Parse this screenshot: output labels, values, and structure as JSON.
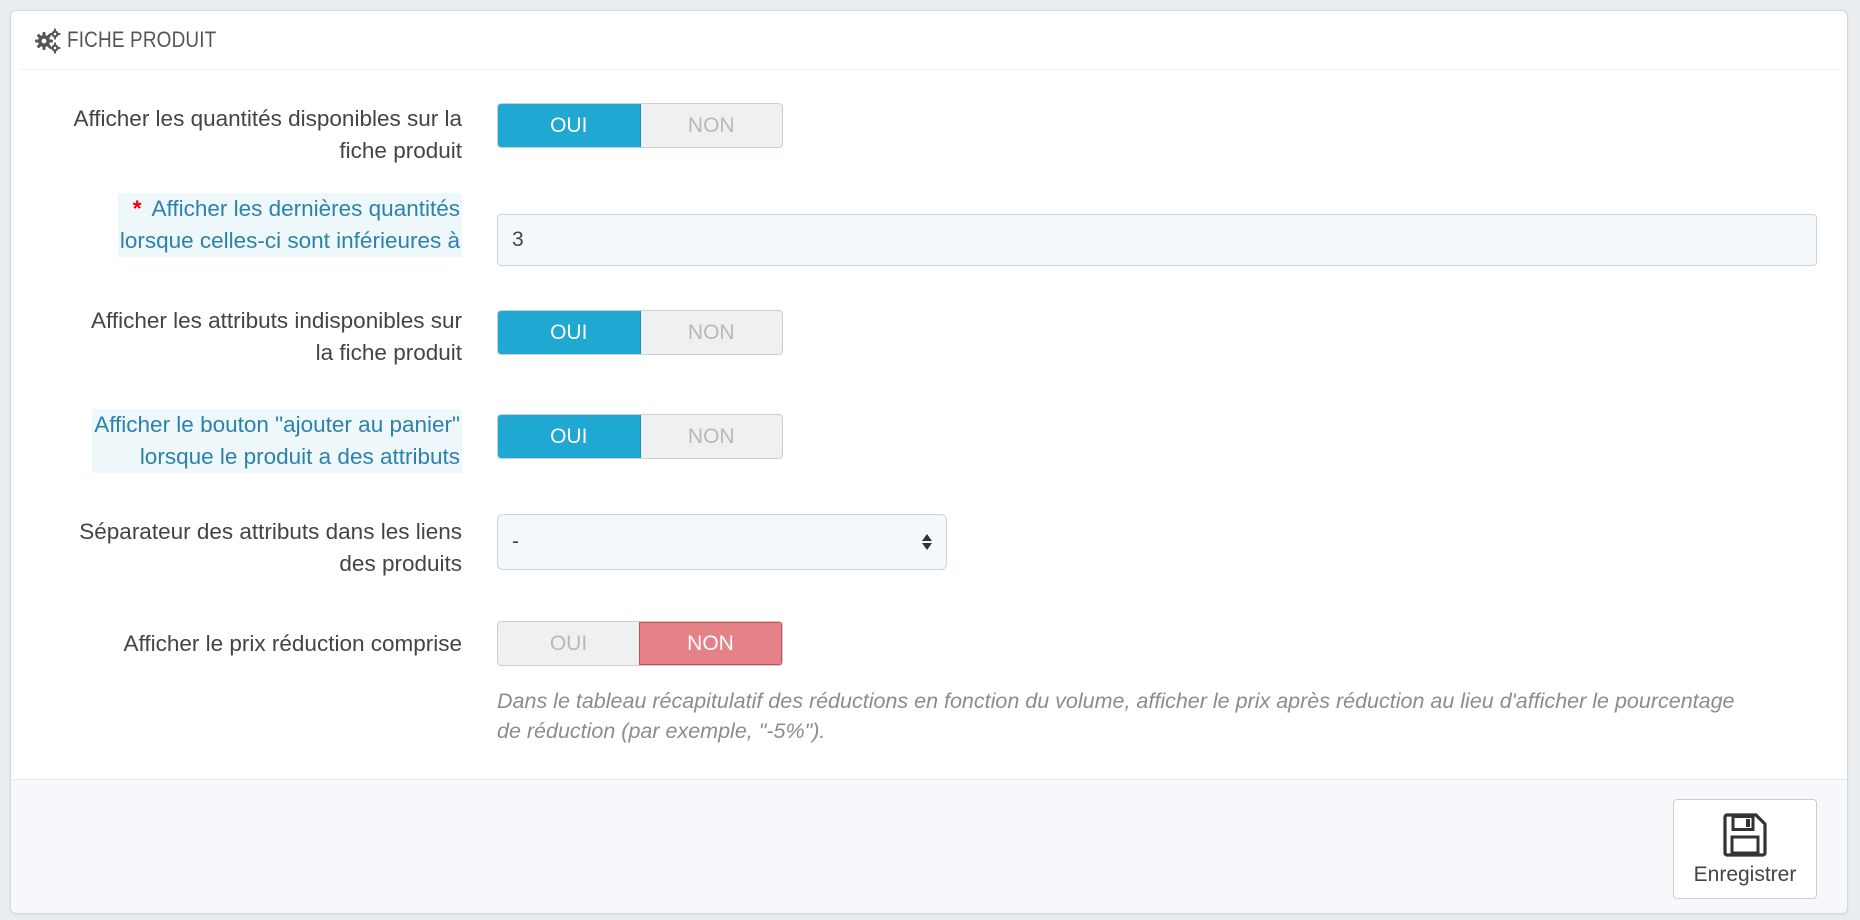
{
  "panel": {
    "title": "FICHE PRODUIT",
    "icon": "cogs-icon"
  },
  "colors": {
    "switch_yes_active": "#1fa8d2",
    "switch_no_active": "#e48287",
    "hint_label": "#2c82ad",
    "required_star": "#ee0000"
  },
  "fields": {
    "display_quantities": {
      "label_line1": "Afficher les quantités disponibles sur la",
      "label_line2": "fiche produit",
      "yes_label": "OUI",
      "no_label": "NON",
      "value": "OUI"
    },
    "last_quantities": {
      "required_mark": "*",
      "label_line1": "Afficher les dernières quantités",
      "label_line2": "lorsque celles-ci sont inférieures à",
      "value": "3"
    },
    "unavailable_attributes": {
      "label_line1": "Afficher les attributs indisponibles sur",
      "label_line2": "la fiche produit",
      "yes_label": "OUI",
      "no_label": "NON",
      "value": "OUI"
    },
    "add_to_cart_button": {
      "label_line1": "Afficher le bouton \"ajouter au panier\"",
      "label_line2": "lorsque le produit a des attributs",
      "yes_label": "OUI",
      "no_label": "NON",
      "value": "OUI"
    },
    "attribute_separator": {
      "label_line1": "Séparateur des attributs dans les liens",
      "label_line2": "des produits",
      "selected": "-"
    },
    "discounted_price": {
      "label_line1": "Afficher le prix réduction comprise",
      "yes_label": "OUI",
      "no_label": "NON",
      "value": "NON",
      "help_line1": "Dans le tableau récapitulatif des réductions en fonction du volume, afficher le prix après réduction au lieu d'afficher le pourcentage",
      "help_line2": "de réduction (par exemple, \"-5%\")."
    }
  },
  "footer": {
    "save_label": "Enregistrer",
    "save_icon": "floppy-disk-icon"
  }
}
